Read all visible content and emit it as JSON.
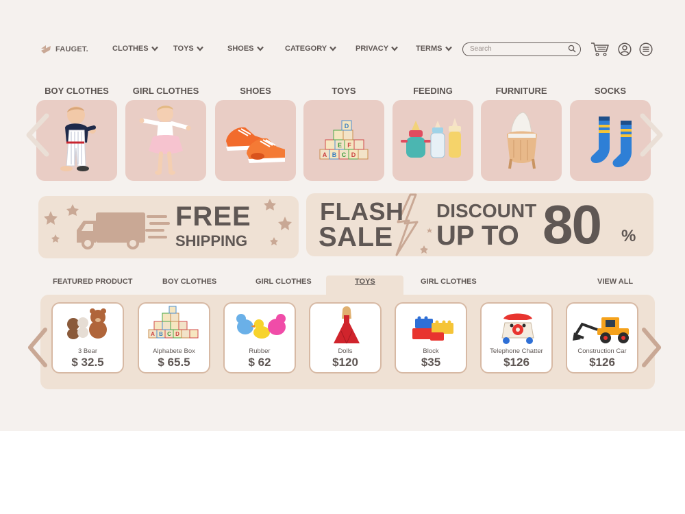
{
  "brand": {
    "name": "FAUGET."
  },
  "nav": [
    {
      "label": "CLOTHES"
    },
    {
      "label": "TOYS"
    },
    {
      "label": "SHOES"
    },
    {
      "label": "CATEGORY"
    },
    {
      "label": "PRIVACY"
    },
    {
      "label": "TERMS"
    }
  ],
  "search": {
    "placeholder": "Search",
    "value": ""
  },
  "header_icons": [
    "cart-icon",
    "user-icon",
    "menu-icon"
  ],
  "categories": [
    {
      "label": "BOY CLOTHES",
      "icon": "baby-boy-photo"
    },
    {
      "label": "GIRL CLOTHES",
      "icon": "baby-girl-photo"
    },
    {
      "label": "SHOES",
      "icon": "sneakers-photo"
    },
    {
      "label": "TOYS",
      "icon": "alphabet-blocks-photo"
    },
    {
      "label": "FEEDING",
      "icon": "baby-bottles-photo"
    },
    {
      "label": "FURNITURE",
      "icon": "bassinet-photo"
    },
    {
      "label": "SOCKS",
      "icon": "socks-photo"
    }
  ],
  "banners": {
    "shipping": {
      "line1": "FREE",
      "line2": "SHIPPING"
    },
    "sale": {
      "line1": "FLASH",
      "line2": "SALE",
      "discount": "DISCOUNT",
      "upto": "UP TO",
      "amount": "80",
      "unit": "%"
    }
  },
  "tabs": [
    {
      "label": "FEATURED PRODUCT",
      "active": false
    },
    {
      "label": "BOY CLOTHES",
      "active": false
    },
    {
      "label": "GIRL CLOTHES",
      "active": false
    },
    {
      "label": "TOYS",
      "active": true
    },
    {
      "label": "GIRL CLOTHES",
      "active": false
    },
    {
      "label": "VIEW ALL",
      "active": false
    }
  ],
  "products": [
    {
      "name": "3 Bear",
      "price": "$ 32.5",
      "icon": "teddy-bears-photo"
    },
    {
      "name": "Alphabete Box",
      "price": "$ 65.5",
      "icon": "alphabet-blocks-photo"
    },
    {
      "name": "Rubber",
      "price": "$ 62",
      "icon": "rubber-toys-photo"
    },
    {
      "name": "Dolls",
      "price": "$120",
      "icon": "doll-photo"
    },
    {
      "name": "Block",
      "price": "$35",
      "icon": "building-blocks-photo"
    },
    {
      "name": "Telephone Chatter",
      "price": "$126",
      "icon": "toy-telephone-photo"
    },
    {
      "name": "Construction Car",
      "price": "$126",
      "icon": "construction-car-photo"
    }
  ],
  "colors": {
    "background": "#f5f1ee",
    "card": "#e9cdc5",
    "banner": "#efe1d4",
    "text": "#5f5754",
    "accent": "#d7b9a4"
  }
}
